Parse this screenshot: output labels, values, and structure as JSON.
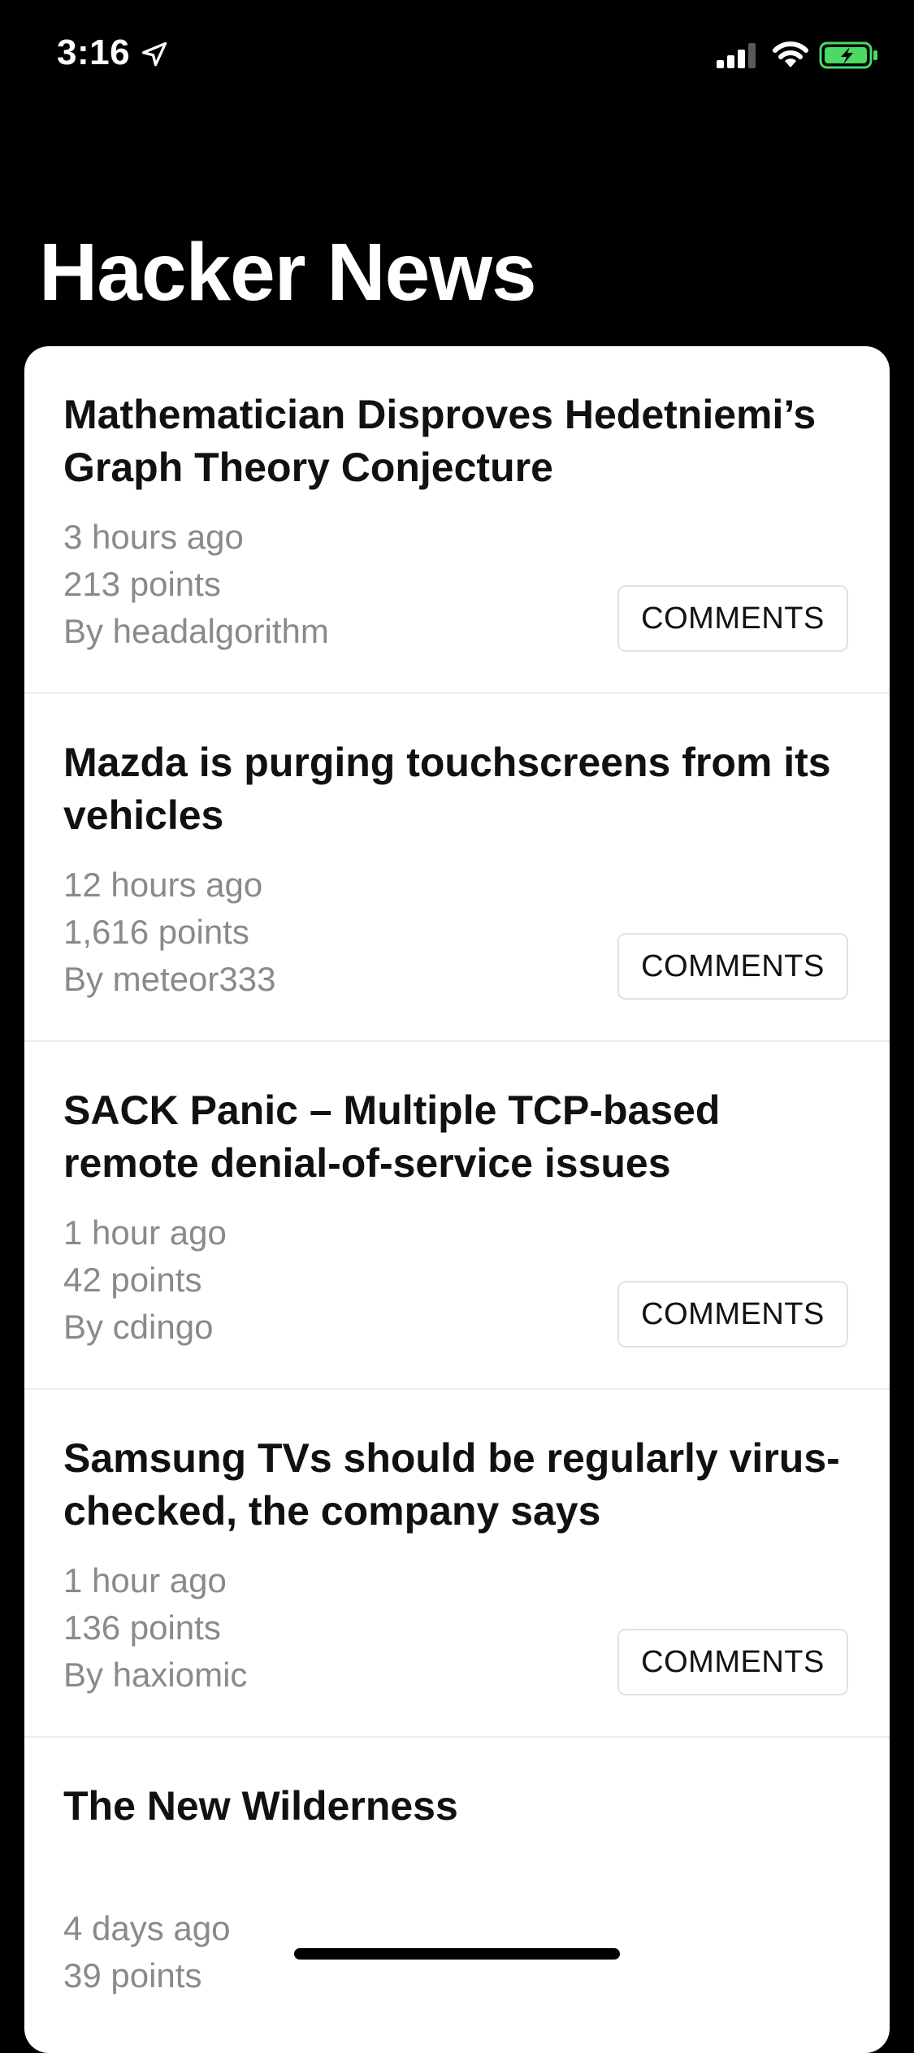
{
  "status_bar": {
    "time": "3:16",
    "icons": [
      "location-arrow-icon",
      "cellular-signal-icon",
      "wifi-icon",
      "battery-charging-icon"
    ],
    "battery_color": "#4cd964"
  },
  "header": {
    "title": "Hacker News"
  },
  "colors": {
    "background": "#000000",
    "card": "#ffffff",
    "title_text": "#111111",
    "meta_text": "#8a8a8a"
  },
  "stories": [
    {
      "title": "Mathematician Disproves Hedetniemi’s Graph Theory Conjecture",
      "time": "3 hours ago",
      "points": "213 points",
      "author": "By headalgorithm",
      "comments_label": "COMMENTS"
    },
    {
      "title": "Mazda is purging touchscreens from its vehicles",
      "time": "12 hours ago",
      "points": "1,616 points",
      "author": "By meteor333",
      "comments_label": "COMMENTS"
    },
    {
      "title": "SACK Panic – Multiple TCP-based remote denial-of-service issues",
      "time": "1 hour ago",
      "points": "42 points",
      "author": "By cdingo",
      "comments_label": "COMMENTS"
    },
    {
      "title": "Samsung TVs should be regularly virus-checked, the company says",
      "time": "1 hour ago",
      "points": "136 points",
      "author": "By haxiomic",
      "comments_label": "COMMENTS"
    },
    {
      "title": "The New Wilderness",
      "time": "4 days ago",
      "points": "39 points"
    }
  ]
}
